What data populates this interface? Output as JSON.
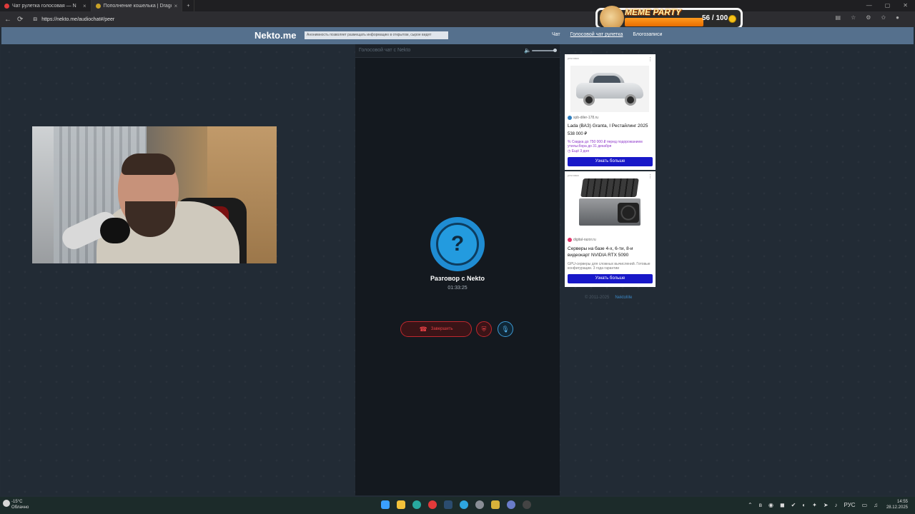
{
  "browser": {
    "tabs": [
      {
        "title": "Чат рулетка голосовая — N",
        "active": false,
        "color": "#e03b3b"
      },
      {
        "title": "Пополнение кошелька | Dragon",
        "active": true,
        "color": "#c9a227"
      }
    ],
    "url": "https://nekto.me/audiochat#/peer",
    "new_tab": "+",
    "close": "×"
  },
  "meme_widget": {
    "title": "MEME PARTY",
    "count": "56 / 100",
    "progress": 0.56
  },
  "header": {
    "logo": "Nekto.me",
    "notice": "Анонимность позволяет размещать информацию в открытом, сырое видят",
    "nav": [
      "Чат",
      "Голосовой чат рулетка",
      "Блогозаписи"
    ],
    "nav_active_index": 1
  },
  "call": {
    "header_title": "Голосовой чат с Nekto",
    "avatar_symbol": "?",
    "title": "Разговор с Nekto",
    "timer": "01:33:25",
    "hangup_label": "Завершить",
    "volume_level": 1.0
  },
  "ads": [
    {
      "label": "реклама",
      "domain": "spb-diler-178.ru",
      "title": "Lada (ВАЗ) Granta, I Рестайлинг 2025",
      "price": "538 000 ₽",
      "promo": "Скидка до 750 000 ₽ перед подорожанием утильсбора до 31 декабря",
      "promo_time": "Ещё 3 дня",
      "button": "Узнать больше"
    },
    {
      "label": "реклама",
      "domain": "digital-razor.ru",
      "title": "Серверы на базе 4-х, 6-ти, 8-и видеокарт NVIDIA RTX 5090",
      "desc": "GPU-серверы для сложных вычислений. Готовые конфигурации. 3 года гарантии",
      "button": "Узнать больше"
    }
  ],
  "footer": {
    "copyright": "© 2011-2025",
    "link": "NektoMe"
  },
  "taskbar": {
    "temp": "-15°C",
    "weather": "Облачно",
    "lang": "РУС",
    "time": "14:55",
    "date": "28.12.2025"
  }
}
